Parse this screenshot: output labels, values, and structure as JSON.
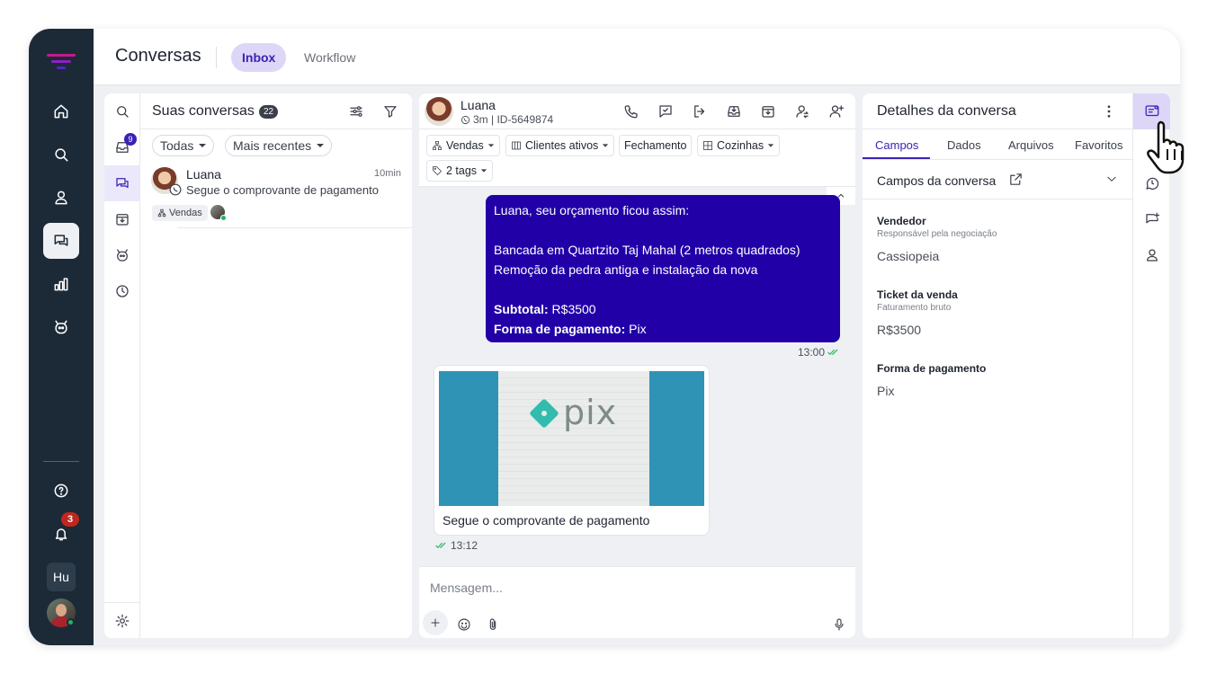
{
  "topbar": {
    "title": "Conversas",
    "tabs": [
      {
        "label": "Inbox"
      },
      {
        "label": "Workflow"
      }
    ]
  },
  "rail": {
    "notifications_count": "3",
    "workspace_initials": "Hu"
  },
  "list": {
    "title": "Suas conversas",
    "count": "22",
    "inbox_badge": "9",
    "filters": {
      "status": "Todas",
      "sort": "Mais recentes"
    },
    "conversations": [
      {
        "name": "Luana",
        "time": "10min",
        "preview": "Segue o comprovante de pagamento",
        "tag": "Vendas"
      }
    ]
  },
  "chat": {
    "contact_name": "Luana",
    "contact_meta": "3m | ID-5649874",
    "filters": {
      "department": "Vendas",
      "stage": "Clientes ativos",
      "step": "Fechamento",
      "category": "Cozinhas",
      "tags": "2 tags"
    },
    "outgoing": {
      "lines": [
        "Luana, seu orçamento ficou assim:",
        "",
        "Bancada em Quartzito Taj Mahal (2 metros quadrados)",
        "Remoção da pedra antiga e instalação da nova",
        ""
      ],
      "subtotal_label": "Subtotal:",
      "subtotal_value": "R$3500",
      "payment_label": "Forma de pagamento:",
      "payment_value": "Pix",
      "time": "13:00"
    },
    "incoming": {
      "image_brand": "pix",
      "caption": "Segue o comprovante de pagamento",
      "time": "13:12"
    },
    "composer_placeholder": "Mensagem..."
  },
  "details": {
    "title": "Detalhes da conversa",
    "tabs": [
      {
        "label": "Campos"
      },
      {
        "label": "Dados"
      },
      {
        "label": "Arquivos"
      },
      {
        "label": "Favoritos"
      }
    ],
    "section_title": "Campos da conversa",
    "fields": [
      {
        "label": "Vendedor",
        "hint": "Responsável pela negociação",
        "value": "Cassiopeia"
      },
      {
        "label": "Ticket da venda",
        "hint": "Faturamento bruto",
        "value": "R$3500"
      },
      {
        "label": "Forma de pagamento",
        "hint": "",
        "value": "Pix"
      }
    ]
  },
  "colors": {
    "rail": "#1c2a38",
    "accent": "#3b22b6",
    "bubble": "#2200a8",
    "tab_active_bg": "#ddd6f7",
    "danger": "#c0271e",
    "online": "#22b35e"
  }
}
